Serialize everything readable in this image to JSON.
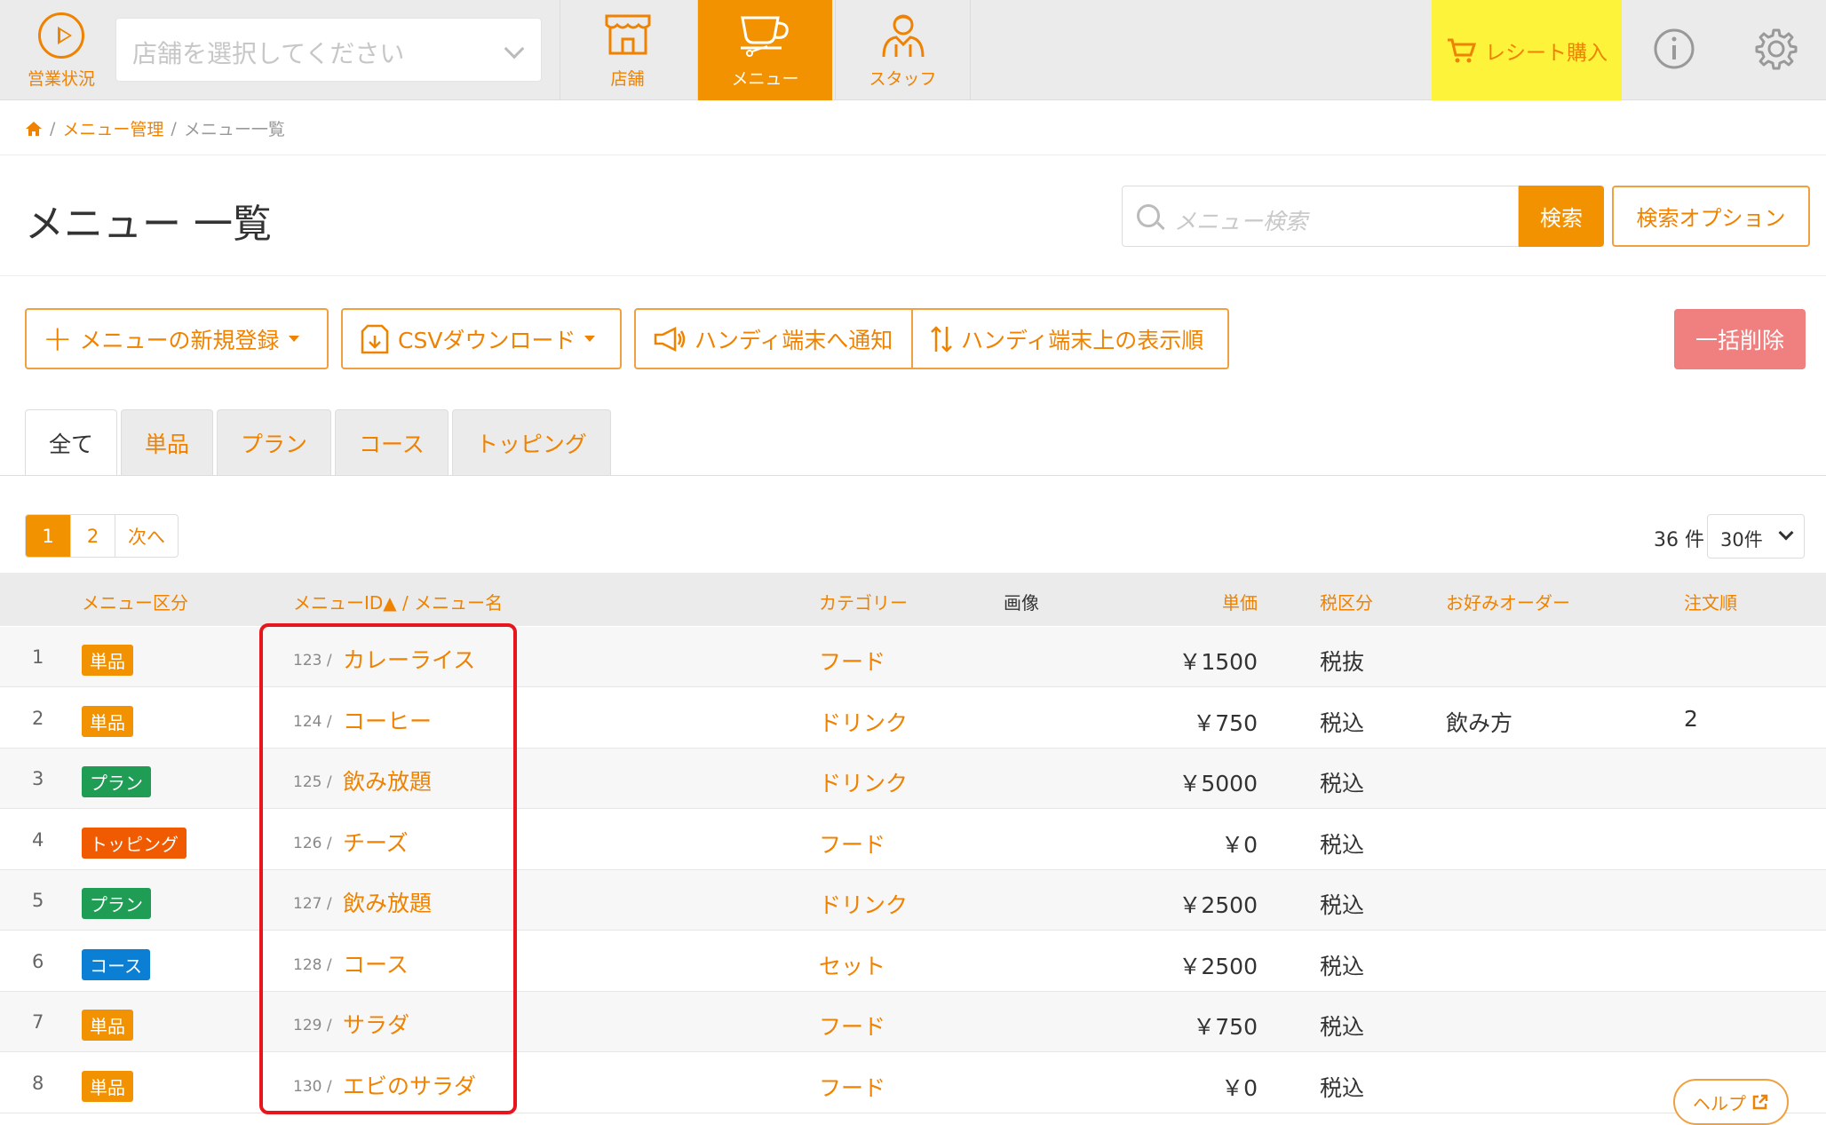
{
  "topbar": {
    "status_label": "営業状況",
    "store_placeholder": "店舗を選択してください",
    "nav": [
      {
        "label": "店舗",
        "icon": "store-icon",
        "active": false
      },
      {
        "label": "メニュー",
        "icon": "cup-icon",
        "active": true
      },
      {
        "label": "スタッフ",
        "icon": "staff-icon",
        "active": false
      }
    ],
    "receipt_label": "レシート購入"
  },
  "breadcrumb": {
    "home": "home-icon",
    "items": [
      "メニュー管理",
      "メニュー一覧"
    ]
  },
  "page": {
    "title": "メニュー 一覧",
    "search_placeholder": "メニュー検索",
    "search_button": "検索",
    "search_options": "検索オプション"
  },
  "actions": {
    "new_menu": "メニューの新規登録",
    "csv_download": "CSVダウンロード",
    "notify_handy": "ハンディ端末へ通知",
    "handy_order": "ハンディ端末上の表示順",
    "bulk_delete": "一括削除"
  },
  "tabs": [
    "全て",
    "単品",
    "プラン",
    "コース",
    "トッピング"
  ],
  "pager": {
    "pages": [
      "1",
      "2"
    ],
    "next": "次へ",
    "count": "36 件",
    "per_page": "30件"
  },
  "table": {
    "headers": {
      "type": "メニュー区分",
      "id_name": "メニューID▲ / メニュー名",
      "category": "カテゴリー",
      "image": "画像",
      "price": "単価",
      "tax": "税区分",
      "preference": "お好みオーダー",
      "order": "注文順"
    },
    "rows": [
      {
        "no": "1",
        "type": "単品",
        "type_color": "#f39200",
        "id": "123 /",
        "name": "カレーライス",
        "category": "フード",
        "price": "￥1500",
        "tax": "税抜",
        "pref": "",
        "order": ""
      },
      {
        "no": "2",
        "type": "単品",
        "type_color": "#f39200",
        "id": "124 /",
        "name": "コーヒー",
        "category": "ドリンク",
        "price": "￥750",
        "tax": "税込",
        "pref": "飲み方",
        "order": "2"
      },
      {
        "no": "3",
        "type": "プラン",
        "type_color": "#1f9d55",
        "id": "125 /",
        "name": "飲み放題",
        "category": "ドリンク",
        "price": "￥5000",
        "tax": "税込",
        "pref": "",
        "order": ""
      },
      {
        "no": "4",
        "type": "トッピング",
        "type_color": "#f05a00",
        "id": "126 /",
        "name": "チーズ",
        "category": "フード",
        "price": "￥0",
        "tax": "税込",
        "pref": "",
        "order": ""
      },
      {
        "no": "5",
        "type": "プラン",
        "type_color": "#1f9d55",
        "id": "127 /",
        "name": "飲み放題",
        "category": "ドリンク",
        "price": "￥2500",
        "tax": "税込",
        "pref": "",
        "order": ""
      },
      {
        "no": "6",
        "type": "コース",
        "type_color": "#0a7fd4",
        "id": "128 /",
        "name": "コース",
        "category": "セット",
        "price": "￥2500",
        "tax": "税込",
        "pref": "",
        "order": ""
      },
      {
        "no": "7",
        "type": "単品",
        "type_color": "#f39200",
        "id": "129 /",
        "name": "サラダ",
        "category": "フード",
        "price": "￥750",
        "tax": "税込",
        "pref": "",
        "order": ""
      },
      {
        "no": "8",
        "type": "単品",
        "type_color": "#f39200",
        "id": "130 /",
        "name": "エビのサラダ",
        "category": "フード",
        "price": "￥0",
        "tax": "税込",
        "pref": "",
        "order": ""
      }
    ]
  },
  "help_label": "ヘルプ",
  "colors": {
    "accent": "#f39200",
    "highlight": "#e8161c",
    "receipt_bg": "#fdf33b",
    "danger": "#f07f7f"
  }
}
